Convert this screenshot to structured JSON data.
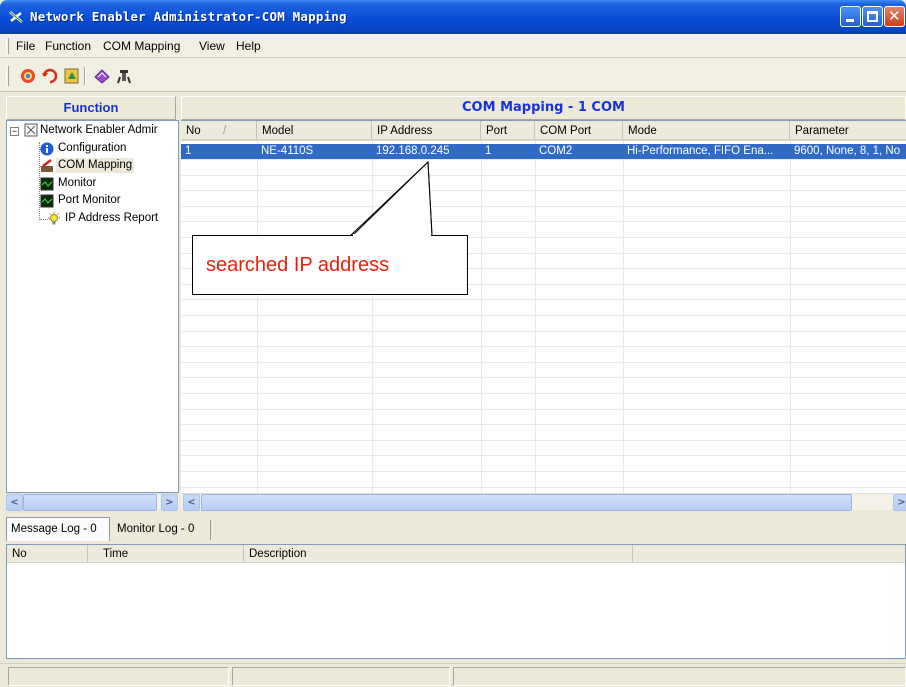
{
  "window": {
    "title": "Network Enabler Administrator-COM Mapping"
  },
  "menu": {
    "file": "File",
    "function": "Function",
    "com_mapping": "COM Mapping",
    "view": "View",
    "help": "Help"
  },
  "toolbar": {
    "icons": [
      "refresh-icon",
      "search-icon",
      "wizard-icon",
      "settings-icon",
      "exit-icon"
    ]
  },
  "panels": {
    "function_header": "Function",
    "mapping_header": "COM Mapping - 1 COM"
  },
  "tree": {
    "root": "Network Enabler Admir",
    "items": [
      {
        "label": "Configuration",
        "icon": "info-icon"
      },
      {
        "label": "COM Mapping",
        "icon": "com-mapping-icon",
        "selected": true
      },
      {
        "label": "Monitor",
        "icon": "monitor-icon"
      },
      {
        "label": "Port Monitor",
        "icon": "port-monitor-icon"
      },
      {
        "label": "IP Address Report",
        "icon": "bulb-icon"
      }
    ]
  },
  "table": {
    "columns": [
      "No",
      "Model",
      "IP Address",
      "Port",
      "COM Port",
      "Mode",
      "Parameter"
    ],
    "sort_indicator": "/",
    "rows": [
      {
        "no": "1",
        "model": "NE-4110S",
        "ip": "192.168.0.245",
        "port": "1",
        "com_port": "COM2",
        "mode": "Hi-Performance, FIFO Ena...",
        "parameter": "9600, None, 8, 1, No"
      }
    ]
  },
  "annotation": {
    "text": "searched IP address"
  },
  "log": {
    "tabs": [
      "Message Log - 0",
      "Monitor Log - 0"
    ],
    "columns": [
      "No",
      "Time",
      "Description"
    ]
  },
  "colors": {
    "title_blue": "#0a4fd6",
    "header_text": "#1733d8",
    "selection": "#316ac5",
    "callout_text": "#e8200e"
  }
}
